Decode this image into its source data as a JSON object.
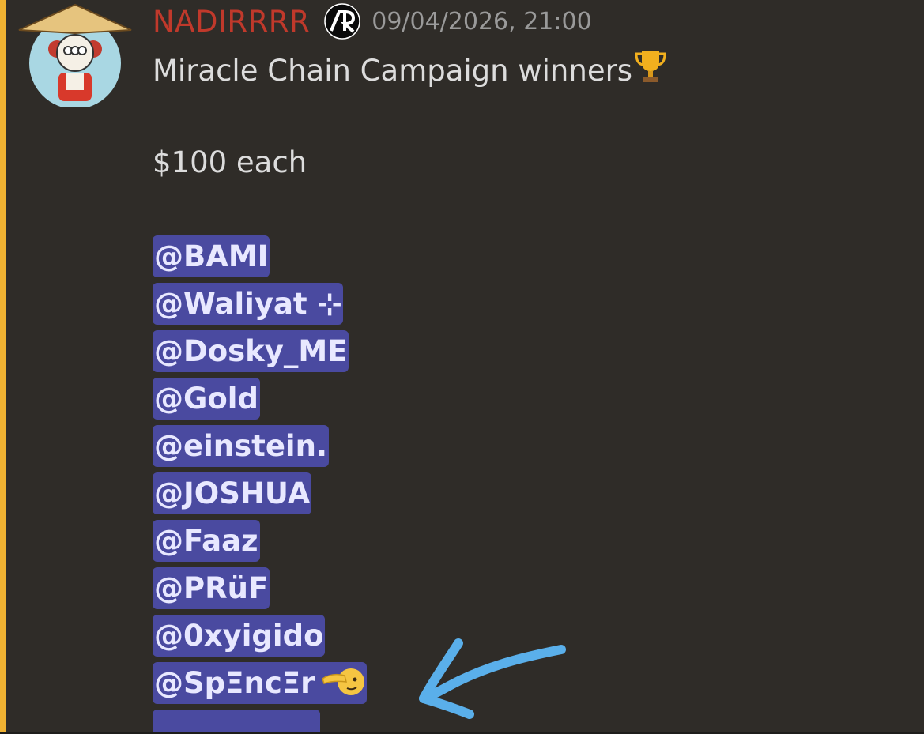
{
  "message": {
    "username": "NADIRRRR",
    "timestamp": "09/04/2026, 21:00",
    "title": "Miracle Chain Campaign winners",
    "amount": "$100 each",
    "mentions": [
      "@BAMI",
      "@Waliyat ⊹",
      "@Dosky_ME",
      "@Gold",
      "@einstein.",
      "@JOSHUA",
      "@Faaz",
      "@PRüF",
      "@0xyigido",
      "@SpΞncΞr"
    ]
  },
  "icons": {
    "avatar": "avatar-icon",
    "role_badge": "ar-badge-icon",
    "trophy": "trophy-icon",
    "salute": "salute-emoji-icon",
    "annotation": "hand-drawn-arrow-icon"
  },
  "colors": {
    "background": "#2f2c28",
    "highlight_bar": "#f0b232",
    "username": "#c0392b",
    "mention_bg": "#4a4aa0",
    "mention_text": "#e8e8ff",
    "arrow": "#5aafea"
  }
}
